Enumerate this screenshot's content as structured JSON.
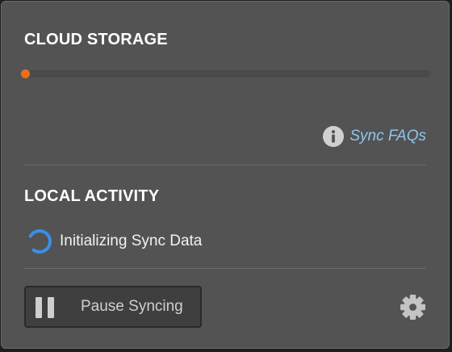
{
  "cloud_storage": {
    "title": "CLOUD STORAGE",
    "used_fraction": 0.0,
    "bar_color": "#ee6d1b",
    "track_color": "#4a4a4a"
  },
  "faq": {
    "icon": "info-icon",
    "label": "Sync FAQs",
    "color": "#8ec6f0"
  },
  "local_activity": {
    "title": "LOCAL ACTIVITY",
    "status_icon": "spinner-icon",
    "status_text": "Initializing Sync Data",
    "spinner_color": "#3b8fe6"
  },
  "footer": {
    "pause_icon": "pause-icon",
    "pause_label": "Pause Syncing",
    "settings_icon": "gear-icon"
  }
}
